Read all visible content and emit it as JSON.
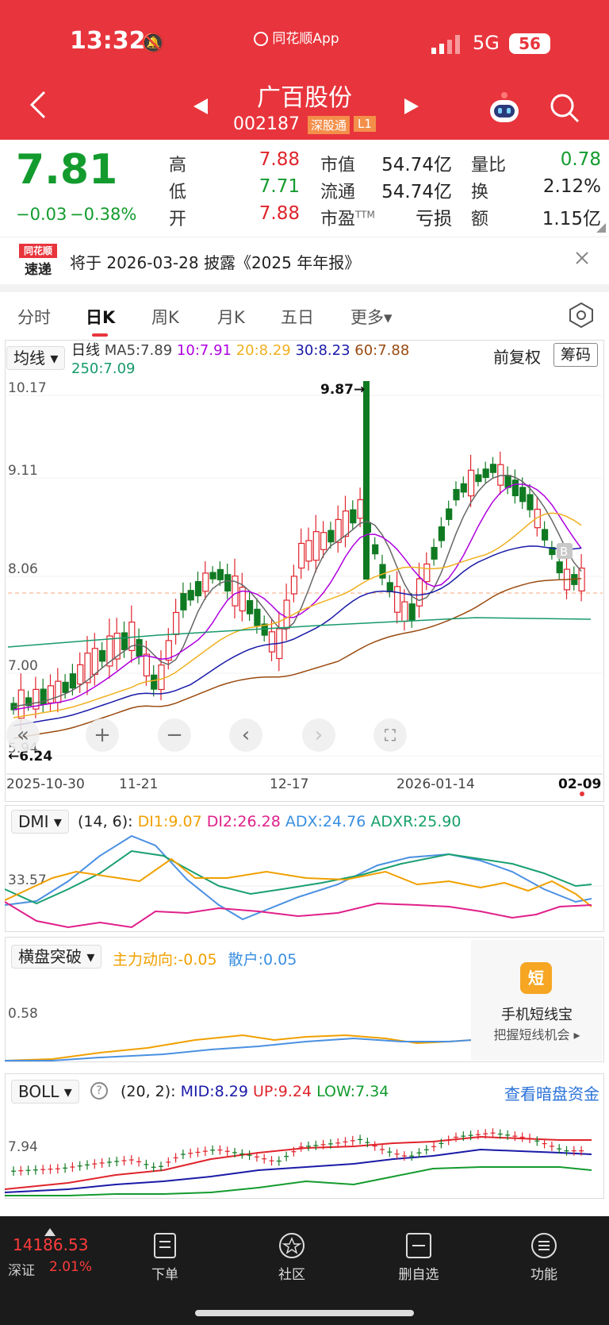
{
  "status_bar": {
    "time": "13:32",
    "app": "同花顺App",
    "network": "5G",
    "battery": "56"
  },
  "header": {
    "title": "广百股份",
    "code": "002187",
    "badge_connect": "深股通",
    "badge_level": "L1"
  },
  "quote": {
    "price": "7.81",
    "change": "−0.03",
    "change_pct": "−0.38%",
    "high_label": "高",
    "high": "7.88",
    "low_label": "低",
    "low": "7.71",
    "open_label": "开",
    "open": "7.88",
    "mcap_label": "市值",
    "mcap": "54.74亿",
    "float_label": "流通",
    "float": "54.74亿",
    "pe_label": "市盈",
    "pe_suffix": "TTM",
    "pe": "亏损",
    "vr_label": "量比",
    "vr": "0.78",
    "turnover_label": "换",
    "turnover": "2.12%",
    "amount_label": "额",
    "amount": "1.15亿"
  },
  "notice": {
    "logo_top": "同花顺",
    "logo_bottom": "速递",
    "text": "将于 2026-03-28 披露《2025 年年报》"
  },
  "tabs": [
    "分时",
    "日K",
    "周K",
    "月K",
    "五日",
    "更多▾"
  ],
  "kline": {
    "ma_select": "均线",
    "period": "日线",
    "ma5": "MA5:7.89",
    "ma10": "10:7.91",
    "ma20": "20:8.29",
    "ma30": "30:8.23",
    "ma60": "60:7.88",
    "ma250": "250:7.09",
    "adjust": "前复权",
    "chip": "筹码",
    "y_labels": [
      "10.17",
      "9.11",
      "8.06",
      "7.00",
      "5.94"
    ],
    "high_mark": "9.87→",
    "low_mark": "←6.24",
    "x_labels": [
      "2025-10-30",
      "11-21",
      "12-17",
      "2026-01-14",
      "02-09"
    ],
    "b_mark": "B"
  },
  "dmi": {
    "select": "DMI",
    "params": "(14, 6):",
    "di1": "DI1:9.07",
    "di2": "DI2:26.28",
    "adx": "ADX:24.76",
    "adxr": "ADXR:25.90",
    "y_label": "33.57"
  },
  "hp": {
    "select": "横盘突破",
    "main": "主力动向:-0.05",
    "retail": "散户:0.05",
    "y_label": "0.58",
    "promo_icon": "短",
    "promo_title": "手机短线宝",
    "promo_sub": "把握短线机会 ▸"
  },
  "boll": {
    "select": "BOLL",
    "params": "(20, 2):",
    "mid": "MID:8.29",
    "up": "UP:9.24",
    "low": "LOW:7.34",
    "link": "查看暗盘资金",
    "y_label": "7.94"
  },
  "bottom": {
    "index_value": "14186.53",
    "index_name": "深证",
    "index_pct": "2.01%",
    "nav": [
      "下单",
      "社区",
      "删自选",
      "功能"
    ]
  },
  "chart_data": {
    "type": "candlestick",
    "y_range": [
      5.94,
      10.17
    ],
    "high": 9.87,
    "low": 6.24,
    "x_ticks": [
      "2025-10-30",
      "11-21",
      "12-17",
      "2026-01-14",
      "02-09"
    ]
  }
}
